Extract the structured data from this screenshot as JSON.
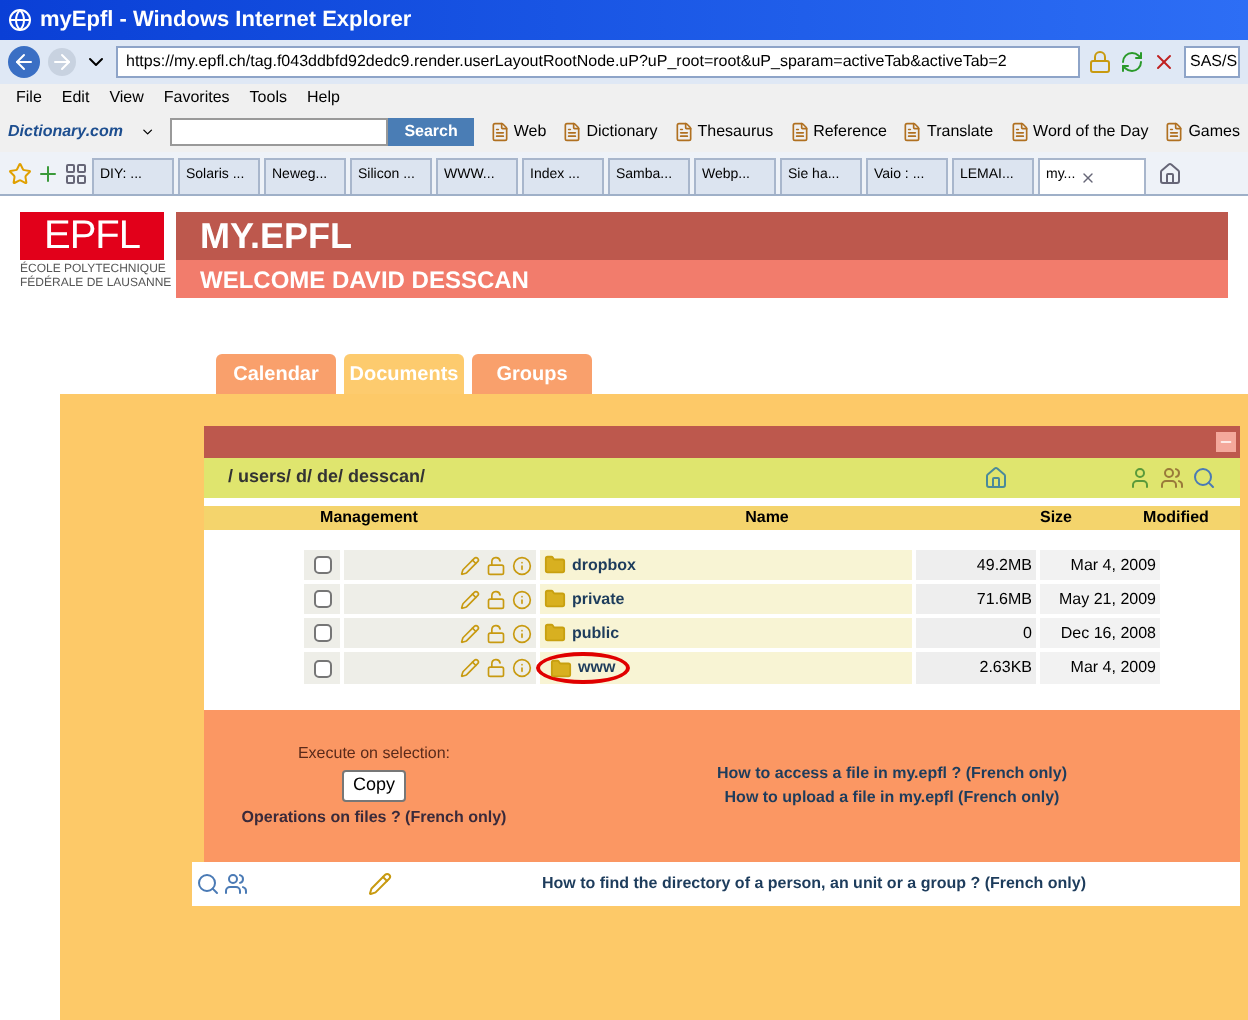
{
  "window": {
    "title": "myEpfl - Windows Internet Explorer"
  },
  "address_bar": {
    "url": "https://my.epfl.ch/tag.f043ddbfd92dedc9.render.userLayoutRootNode.uP?uP_root=root&uP_sparam=activeTab&activeTab=2",
    "search_text": "SAS/S"
  },
  "menu": [
    "File",
    "Edit",
    "View",
    "Favorites",
    "Tools",
    "Help"
  ],
  "dictionary_toolbar": {
    "logo": "Dictionary.com",
    "search_button": "Search",
    "links": [
      "Web",
      "Dictionary",
      "Thesaurus",
      "Reference",
      "Translate",
      "Word of the Day",
      "Games"
    ]
  },
  "browser_tabs": [
    {
      "label": "DIY: ...",
      "selected": false
    },
    {
      "label": "Solaris ...",
      "selected": false
    },
    {
      "label": "Neweg...",
      "selected": false
    },
    {
      "label": "Silicon ...",
      "selected": false
    },
    {
      "label": "WWW...",
      "selected": false
    },
    {
      "label": "Index ...",
      "selected": false
    },
    {
      "label": "Samba...",
      "selected": false
    },
    {
      "label": "Webp...",
      "selected": false
    },
    {
      "label": "Sie ha...",
      "selected": false
    },
    {
      "label": "Vaio : ...",
      "selected": false
    },
    {
      "label": "LEMAI...",
      "selected": false
    },
    {
      "label": "my...",
      "selected": true
    }
  ],
  "site": {
    "logo": "EPFL",
    "school_line_1": "ÉCOLE POLYTECHNIQUE",
    "school_line_2": "FÉDÉRALE DE LAUSANNE",
    "title": "MY.EPFL",
    "welcome": "WELCOME DAVID DESSCAN"
  },
  "tabs": [
    {
      "label": "Calendar",
      "selected": false
    },
    {
      "label": "Documents",
      "selected": true
    },
    {
      "label": "Groups",
      "selected": false
    }
  ],
  "path": "/ users/ d/ de/ desscan/",
  "table": {
    "columns": [
      "Management",
      "Name",
      "Size",
      "Modified"
    ],
    "rows": [
      {
        "checked": false,
        "name": "dropbox",
        "size": "49.2MB",
        "modified": "Mar 4, 2009",
        "circled": false
      },
      {
        "checked": false,
        "name": "private",
        "size": "71.6MB",
        "modified": "May 21, 2009",
        "circled": false
      },
      {
        "checked": false,
        "name": "public",
        "size": "0",
        "modified": "Dec 16, 2008",
        "circled": false
      },
      {
        "checked": false,
        "name": "www",
        "size": "2.63KB",
        "modified": "Mar 4, 2009",
        "circled": true
      }
    ]
  },
  "actions": {
    "label": "Execute on selection:",
    "button": "Copy",
    "help": "Operations on files ? (French only)",
    "links": [
      "How to access a file in my.epfl ? (French only)",
      "How to upload a file in my.epfl (French only)"
    ]
  },
  "footer": {
    "link": "How to find the directory of a person, an unit or a group ? (French only)"
  }
}
